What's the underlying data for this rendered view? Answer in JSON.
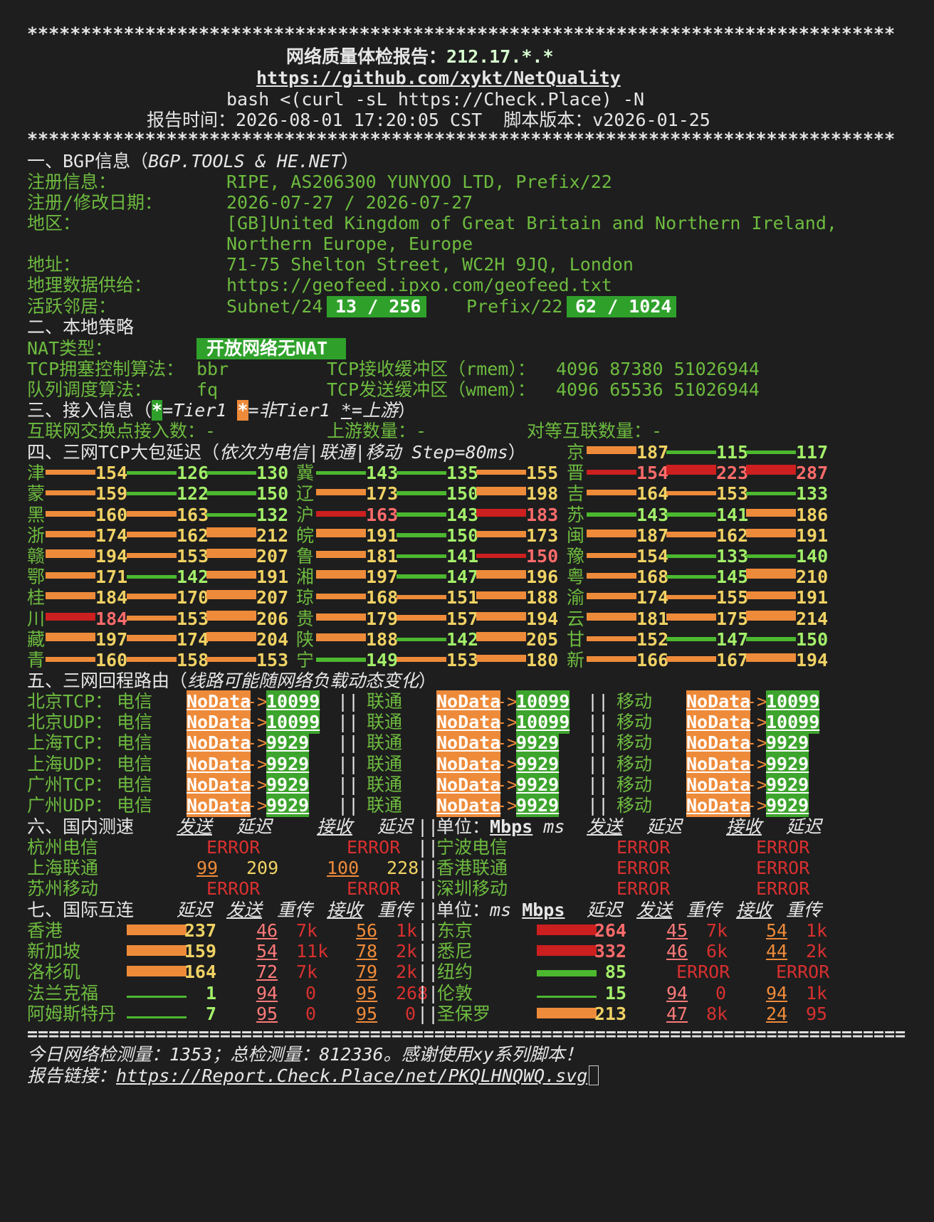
{
  "stars": "*********************************************************************************",
  "sep": "==================================================================================",
  "header": {
    "title": "网络质量体检报告：",
    "ip": "212.17.*.*",
    "url": "https://github.com/xykt/NetQuality",
    "cmd": "bash <(curl -sL https://Check.Place) -N",
    "time": "报告时间：2026-08-01 17:20:05 CST  脚本版本：v2026-01-25"
  },
  "s1": {
    "head": "一、BGP信息（",
    "head_i": "BGP.TOOLS & HE.NET",
    "head_end": "）",
    "reg_label": "注册信息：",
    "reg": "RIPE, AS206300 YUNYOO LTD, Prefix/22",
    "date_label": "注册/修改日期：",
    "date": "2026-07-27 / 2026-07-27",
    "region_label": "地区：",
    "region1": "[GB]United Kingdom of Great Britain and Northern Ireland,",
    "region2": "Northern Europe, Europe",
    "addr_label": "地址：",
    "addr": "71-75 Shelton Street, WC2H 9JQ, London",
    "geo_label": "地理数据供给：",
    "geo": "https://geofeed.ipxo.com/geofeed.txt",
    "nb_label": "活跃邻居：",
    "subnet": "Subnet/24",
    "subnet_val": "13 / 256",
    "prefix": "Prefix/22",
    "prefix_val": "62 / 1024"
  },
  "s2": {
    "head": "二、本地策略",
    "nat_label": "NAT类型：",
    "nat": "开放网络无NAT",
    "tcp_label": "TCP拥塞控制算法：",
    "tcp": "bbr",
    "rmem_label": "TCP接收缓冲区（rmem）：",
    "rmem": "4096 87380 51026944",
    "q_label": "队列调度算法：",
    "q": "fq",
    "wmem_label": "TCP发送缓冲区（wmem）：",
    "wmem": "4096 65536 51026944"
  },
  "s3": {
    "head": "三、接入信息（",
    "tier1": "*",
    "tier1_txt": "=Tier1 ",
    "ntier1": "*",
    "ntier1_txt": "=非Tier1 ",
    "up": "*",
    "up_txt": "=上游",
    "end": "）",
    "ix_label": "互联网交换点接入数：",
    "ix": "-",
    "up_label": "上游数量：",
    "upn": "-",
    "peer_label": "对等互联数量：",
    "peer": "-"
  },
  "s4": {
    "head": "四、三网TCP大包延迟（",
    "head_i": "依次为电信|联通|移动 Step=80ms",
    "head_end": "）",
    "cells": [
      {
        "p": "京",
        "v": [
          187,
          115,
          117
        ],
        "t": [
          "o",
          "g",
          "g"
        ]
      },
      {
        "p": "津",
        "v": [
          154,
          126,
          130
        ],
        "t": [
          "o",
          "g",
          "g"
        ]
      },
      {
        "p": "冀",
        "v": [
          143,
          135,
          155
        ],
        "t": [
          "g",
          "g",
          "o"
        ]
      },
      {
        "p": "晋",
        "v": [
          154,
          223,
          287
        ],
        "t": [
          "r",
          "r",
          "r"
        ]
      },
      {
        "p": "蒙",
        "v": [
          159,
          122,
          150
        ],
        "t": [
          "o",
          "g",
          "g"
        ]
      },
      {
        "p": "辽",
        "v": [
          173,
          150,
          198
        ],
        "t": [
          "o",
          "g",
          "o"
        ]
      },
      {
        "p": "吉",
        "v": [
          164,
          153,
          133
        ],
        "t": [
          "o",
          "o",
          "g"
        ]
      },
      {
        "p": "黑",
        "v": [
          160,
          163,
          132
        ],
        "t": [
          "o",
          "o",
          "g"
        ]
      },
      {
        "p": "沪",
        "v": [
          163,
          143,
          183
        ],
        "t": [
          "r",
          "g",
          "r"
        ]
      },
      {
        "p": "苏",
        "v": [
          143,
          141,
          186
        ],
        "t": [
          "g",
          "g",
          "o"
        ]
      },
      {
        "p": "浙",
        "v": [
          174,
          162,
          212
        ],
        "t": [
          "o",
          "o",
          "o"
        ]
      },
      {
        "p": "皖",
        "v": [
          191,
          150,
          173
        ],
        "t": [
          "o",
          "g",
          "o"
        ]
      },
      {
        "p": "闽",
        "v": [
          187,
          162,
          191
        ],
        "t": [
          "o",
          "o",
          "o"
        ]
      },
      {
        "p": "赣",
        "v": [
          194,
          153,
          207
        ],
        "t": [
          "o",
          "o",
          "o"
        ]
      },
      {
        "p": "鲁",
        "v": [
          181,
          141,
          150
        ],
        "t": [
          "o",
          "g",
          "r"
        ]
      },
      {
        "p": "豫",
        "v": [
          154,
          133,
          140
        ],
        "t": [
          "o",
          "g",
          "g"
        ]
      },
      {
        "p": "鄂",
        "v": [
          171,
          142,
          191
        ],
        "t": [
          "o",
          "g",
          "o"
        ]
      },
      {
        "p": "湘",
        "v": [
          197,
          147,
          196
        ],
        "t": [
          "o",
          "g",
          "o"
        ]
      },
      {
        "p": "粤",
        "v": [
          168,
          145,
          210
        ],
        "t": [
          "o",
          "g",
          "o"
        ]
      },
      {
        "p": "桂",
        "v": [
          184,
          170,
          207
        ],
        "t": [
          "o",
          "o",
          "o"
        ]
      },
      {
        "p": "琼",
        "v": [
          168,
          151,
          188
        ],
        "t": [
          "o",
          "o",
          "o"
        ]
      },
      {
        "p": "渝",
        "v": [
          174,
          155,
          191
        ],
        "t": [
          "o",
          "o",
          "o"
        ]
      },
      {
        "p": "川",
        "v": [
          184,
          153,
          206
        ],
        "t": [
          "r",
          "o",
          "o"
        ]
      },
      {
        "p": "贵",
        "v": [
          179,
          157,
          194
        ],
        "t": [
          "o",
          "o",
          "o"
        ]
      },
      {
        "p": "云",
        "v": [
          181,
          175,
          214
        ],
        "t": [
          "o",
          "o",
          "o"
        ]
      },
      {
        "p": "藏",
        "v": [
          197,
          174,
          204
        ],
        "t": [
          "o",
          "o",
          "o"
        ]
      },
      {
        "p": "陕",
        "v": [
          188,
          142,
          205
        ],
        "t": [
          "o",
          "g",
          "o"
        ]
      },
      {
        "p": "甘",
        "v": [
          152,
          147,
          150
        ],
        "t": [
          "o",
          "g",
          "g"
        ]
      },
      {
        "p": "青",
        "v": [
          160,
          158,
          153
        ],
        "t": [
          "o",
          "o",
          "o"
        ]
      },
      {
        "p": "宁",
        "v": [
          149,
          153,
          180
        ],
        "t": [
          "g",
          "o",
          "o"
        ]
      },
      {
        "p": "新",
        "v": [
          166,
          167,
          194
        ],
        "t": [
          "o",
          "o",
          "o"
        ]
      }
    ]
  },
  "s5": {
    "head": "五、三网回程路由（",
    "head_i": "线路可能随网络负载动态变化",
    "head_end": "）",
    "isp": [
      "电信",
      "联通",
      "移动"
    ],
    "nodata": "NoData",
    "arrow": "->",
    "sep": "||",
    "rows": [
      {
        "label": "北京TCP：",
        "as": "10099"
      },
      {
        "label": "北京UDP：",
        "as": "10099"
      },
      {
        "label": "上海TCP：",
        "as": "9929"
      },
      {
        "label": "上海UDP：",
        "as": "9929"
      },
      {
        "label": "广州TCP：",
        "as": "9929"
      },
      {
        "label": "广州UDP：",
        "as": "9929"
      }
    ]
  },
  "s6": {
    "head": "六、国内测速",
    "send": "发送",
    "lat": "延迟",
    "recv": "接收",
    "unit": "单位：",
    "mbps": "Mbps",
    "ms": "ms",
    "sep": "||",
    "left": [
      {
        "n": "杭州电信",
        "err": "ERROR"
      },
      {
        "n": "上海联通",
        "s": "99",
        "l": "209",
        "r": "100",
        "l2": "228"
      },
      {
        "n": "苏州移动",
        "err": "ERROR"
      }
    ],
    "right": [
      {
        "n": "宁波电信",
        "err": "ERROR"
      },
      {
        "n": "香港联通",
        "err": "ERROR"
      },
      {
        "n": "深圳移动",
        "err": "ERROR"
      }
    ]
  },
  "s7": {
    "head": "七、国际互连",
    "lat": "延迟",
    "send": "发送",
    "retx": "重传",
    "recv": "接收",
    "unit": "单位：",
    "ms": "ms",
    "mbps": "Mbps",
    "sep": "||",
    "err": "ERROR",
    "left": [
      {
        "n": "香港",
        "lat": "237",
        "s": "46",
        "sr": "7k",
        "r": "56",
        "rr": "1k",
        "c": "o",
        "bar": 1.0
      },
      {
        "n": "新加坡",
        "lat": "159",
        "s": "54",
        "sr": "11k",
        "r": "78",
        "rr": "2k",
        "c": "o",
        "bar": 1.0
      },
      {
        "n": "洛杉矶",
        "lat": "164",
        "s": "72",
        "sr": "7k",
        "r": "79",
        "rr": "2k",
        "c": "o",
        "bar": 1.0
      },
      {
        "n": "法兰克福",
        "lat": "1",
        "s": "94",
        "sr": "0",
        "r": "95",
        "rr": "268",
        "c": "g",
        "bar": 0.1
      },
      {
        "n": "阿姆斯特丹",
        "lat": "7",
        "s": "95",
        "sr": "0",
        "r": "95",
        "rr": "0",
        "c": "g",
        "bar": 0.1
      }
    ],
    "right": [
      {
        "n": "东京",
        "lat": "264",
        "s": "45",
        "sr": "7k",
        "r": "54",
        "rr": "1k",
        "c": "r",
        "bar": 1.0
      },
      {
        "n": "悉尼",
        "lat": "332",
        "s": "46",
        "sr": "6k",
        "r": "44",
        "rr": "2k",
        "c": "r",
        "bar": 1.0
      },
      {
        "n": "纽约",
        "lat": "85",
        "err": true,
        "c": "g",
        "bar": 0.55
      },
      {
        "n": "伦敦",
        "lat": "15",
        "s": "94",
        "sr": "0",
        "r": "94",
        "rr": "1k",
        "c": "g",
        "bar": 0.15
      },
      {
        "n": "圣保罗",
        "lat": "213",
        "s": "47",
        "sr": "8k",
        "r": "24",
        "rr": "95",
        "c": "o",
        "bar": 1.0
      }
    ]
  },
  "footer": {
    "l1": "今日网络检测量：1353；总检测量：812336。感谢使用xy系列脚本！",
    "l2_label": "报告链接：",
    "l2_link": "https://Report.Check.Place/net/PKQLHNQWQ.svg"
  },
  "colors": {
    "bg": "#1e1e1e",
    "green": "#6dbb3f",
    "orange": "#ee8b3a",
    "red": "#d83030",
    "box_green": "#2fa12b"
  }
}
